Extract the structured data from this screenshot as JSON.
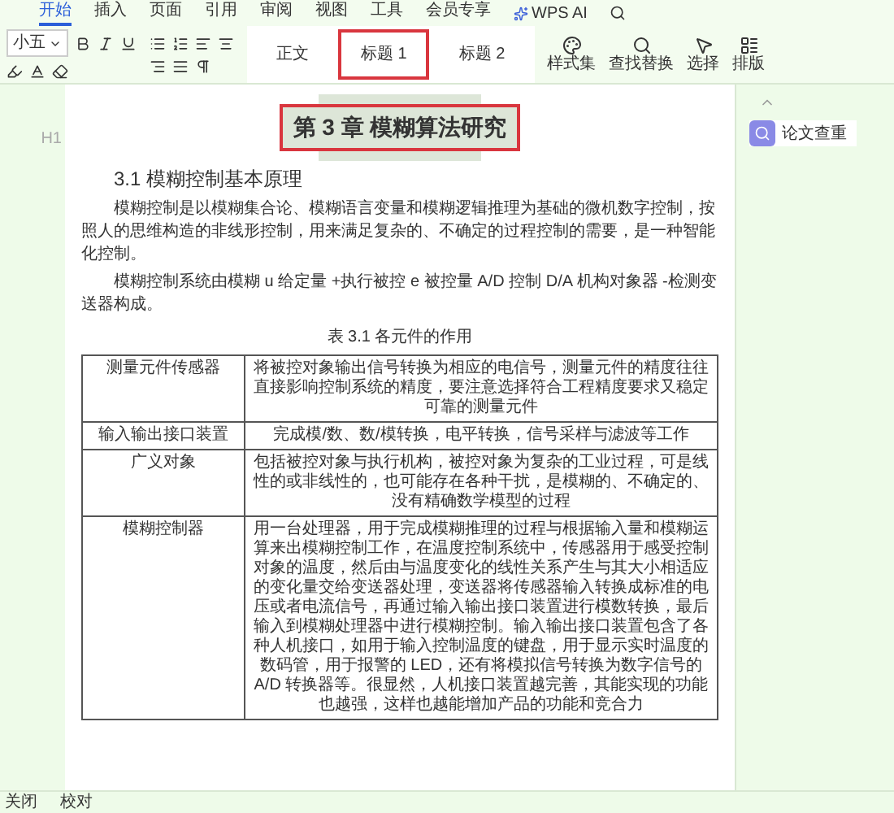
{
  "menu_tabs": [
    {
      "label": "开始",
      "selected": true
    },
    {
      "label": "插入",
      "selected": false
    },
    {
      "label": "页面",
      "selected": false
    },
    {
      "label": "引用",
      "selected": false
    },
    {
      "label": "审阅",
      "selected": false
    },
    {
      "label": "视图",
      "selected": false
    },
    {
      "label": "工具",
      "selected": false
    },
    {
      "label": "会员专享",
      "selected": false
    }
  ],
  "ai_button": "WPS AI",
  "font_size": "小五",
  "styles": [
    {
      "label": "正文",
      "selected": false
    },
    {
      "label": "标题 1",
      "selected": true
    },
    {
      "label": "标题 2",
      "selected": false
    }
  ],
  "tools": [
    "样式集",
    "查找替换",
    "选择",
    "排版"
  ],
  "sidebar": {
    "button": "论文查重"
  },
  "document": {
    "heading_marker": "H1",
    "chapter_title": "第 3 章  模糊算法研究",
    "section_title": "3.1  模糊控制基本原理",
    "paragraphs": [
      "模糊控制是以模糊集合论、模糊语言变量和模糊逻辑推理为基础的微机数字控制，按照人的思维构造的非线形控制，用来满足复杂的、不确定的过程控制的需要，是一种智能化控制。",
      "模糊控制系统由模糊 u 给定量 +执行被控 e 被控量 A/D 控制 D/A 机构对象器 -检测变送器构成。"
    ],
    "table_caption": "表 3.1 各元件的作用",
    "table_rows": [
      {
        "component": "测量元件传感器",
        "role": "将被控对象输出信号转换为相应的电信号，测量元件的精度往往直接影响控制系统的精度，要注意选择符合工程精度要求又稳定可靠的测量元件"
      },
      {
        "component": "输入输出接口装置",
        "role": "完成模/数、数/模转换，电平转换，信号采样与滤波等工作"
      },
      {
        "component": "广义对象",
        "role": "包括被控对象与执行机构，被控对象为复杂的工业过程，可是线性的或非线性的，也可能存在各种干扰，是模糊的、不确定的、没有精确数学模型的过程"
      },
      {
        "component": "模糊控制器",
        "role": "用一台处理器，用于完成模糊推理的过程与根据输入量和模糊运算来出模糊控制工作，在温度控制系统中，传感器用于感受控制对象的温度，然后由与温度变化的线性关系产生与其大小相适应的变化量交给变送器处理，变送器将传感器输入转换成标准的电压或者电流信号，再通过输入输出接口装置进行模数转换，最后输入到模糊处理器中进行模糊控制。输入输出接口装置包含了各种人机接口，如用于输入控制温度的键盘，用于显示实时温度的数码管，用于报警的 LED，还有将模拟信号转换为数字信号的 A/D 转换器等。很显然，人机接口装置越完善，其能实现的功能也越强，这样也越能增加产品的功能和竞合力"
      }
    ]
  },
  "status_bar": [
    "关闭",
    "校对"
  ]
}
